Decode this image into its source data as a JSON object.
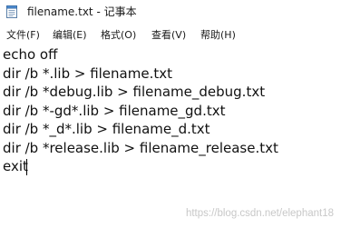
{
  "window": {
    "title": "filename.txt - 记事本",
    "icon": "notepad-icon"
  },
  "menu": [
    "文件(F)",
    "编辑(E)",
    "格式(O)",
    "查看(V)",
    "帮助(H)"
  ],
  "editor": {
    "lines": [
      "echo off",
      "dir /b *.lib > filename.txt",
      "dir /b *debug.lib > filename_debug.txt",
      "dir /b *-gd*.lib > filename_gd.txt",
      "dir /b *_d*.lib > filename_d.txt",
      "dir /b *release.lib > filename_release.txt",
      "exit"
    ]
  },
  "watermark": "https://blog.csdn.net/elephant18"
}
